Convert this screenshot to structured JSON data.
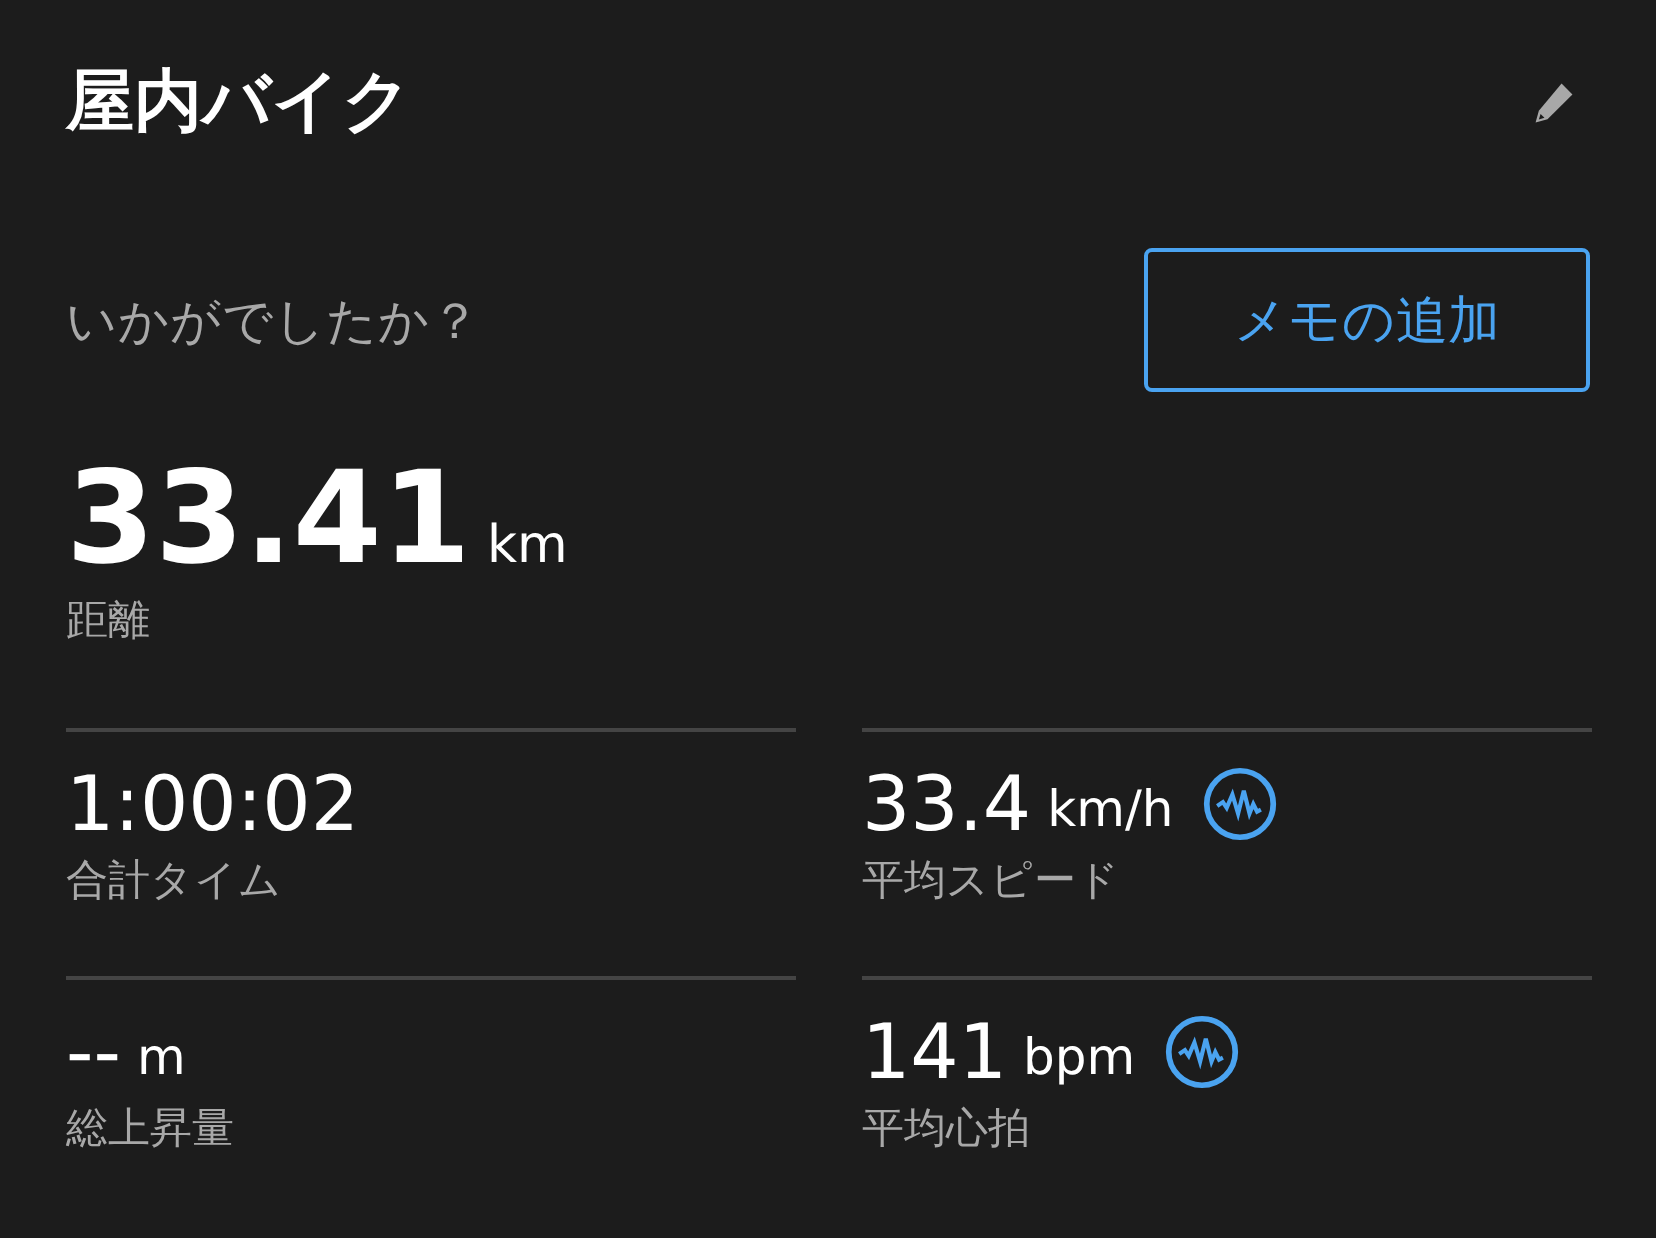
{
  "title": "屋内バイク",
  "question": "いかがでしたか？",
  "memo_button": "メモの追加",
  "distance": {
    "value": "33.41",
    "unit": "km",
    "label": "距離"
  },
  "stats": [
    {
      "value": "1:00:02",
      "label": "合計タイム",
      "chart": false
    },
    {
      "value": "33.4",
      "unit": "km/h",
      "label": "平均スピード",
      "chart": true
    },
    {
      "value": "--",
      "unit": "m",
      "label": "総上昇量",
      "chart": false
    },
    {
      "value": "141",
      "unit": "bpm",
      "label": "平均心拍",
      "chart": true
    }
  ]
}
